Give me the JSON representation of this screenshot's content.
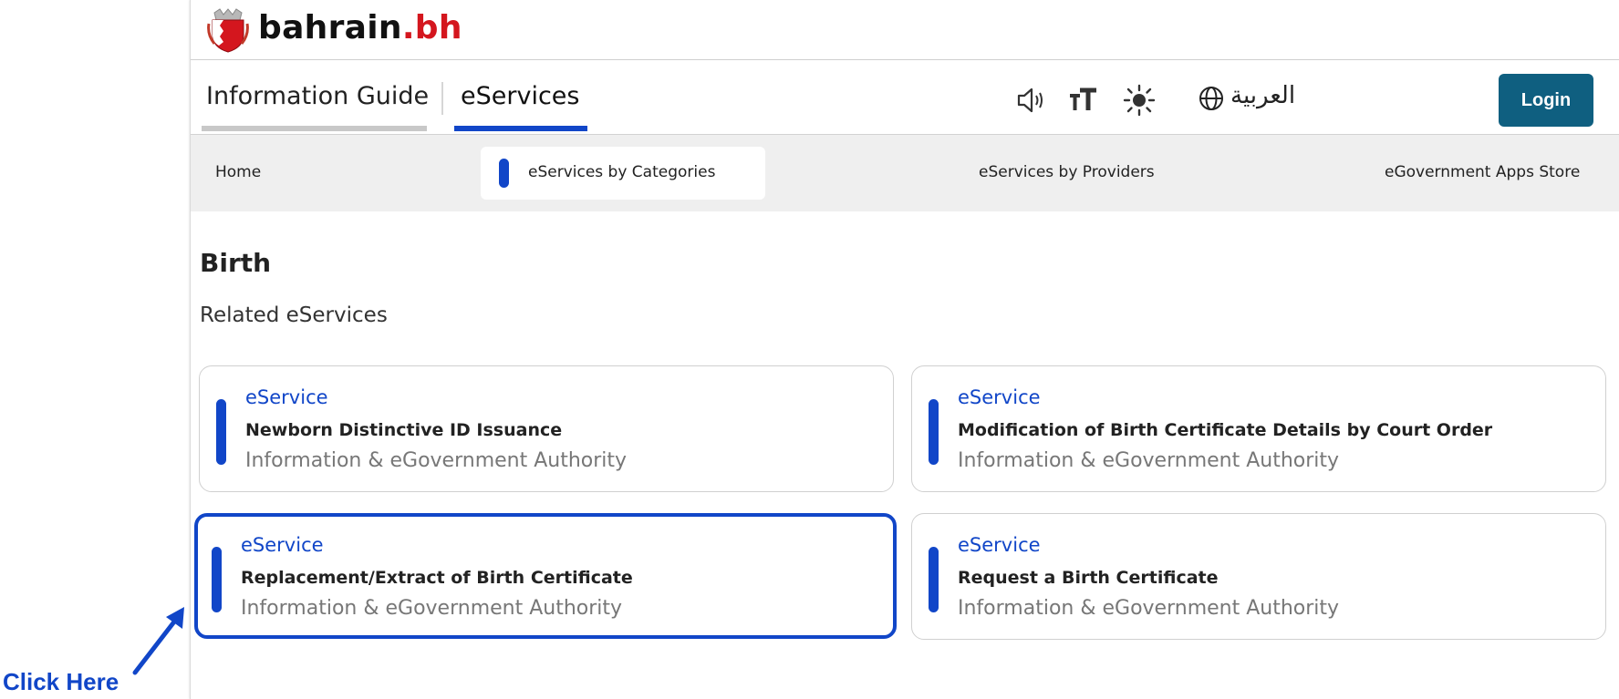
{
  "brand": {
    "name": "bahrain",
    "tld": ".bh"
  },
  "topnav": {
    "tabs": [
      {
        "label": "Information Guide",
        "active": false
      },
      {
        "label": "eServices",
        "active": true
      }
    ],
    "icons": [
      "speaker-icon",
      "text-size-icon",
      "contrast-icon"
    ],
    "language_label": "العربية",
    "login_label": "Login"
  },
  "subnav": {
    "items": [
      {
        "label": "Home",
        "active": false
      },
      {
        "label": "eServices by Categories",
        "active": true
      },
      {
        "label": "eServices by Providers",
        "active": false
      },
      {
        "label": "eGovernment Apps Store",
        "active": false
      }
    ]
  },
  "page": {
    "title": "Birth",
    "section_label": "Related eServices"
  },
  "cards": [
    {
      "kind": "eService",
      "title": "Newborn Distinctive ID Issuance",
      "provider": "Information & eGovernment Authority",
      "highlighted": false
    },
    {
      "kind": "eService",
      "title": "Modification of Birth Certificate Details by Court Order",
      "provider": "Information & eGovernment Authority",
      "highlighted": false
    },
    {
      "kind": "eService",
      "title": "Replacement/Extract of Birth Certificate",
      "provider": "Information & eGovernment Authority",
      "highlighted": true
    },
    {
      "kind": "eService",
      "title": "Request a Birth Certificate",
      "provider": "Information & eGovernment Authority",
      "highlighted": false
    }
  ],
  "annotation": {
    "text": "Click Here"
  },
  "colors": {
    "accent": "#1146c8",
    "brand_red": "#d4161e",
    "login_bg": "#0f5f80",
    "subnav_bg": "#efefef"
  }
}
